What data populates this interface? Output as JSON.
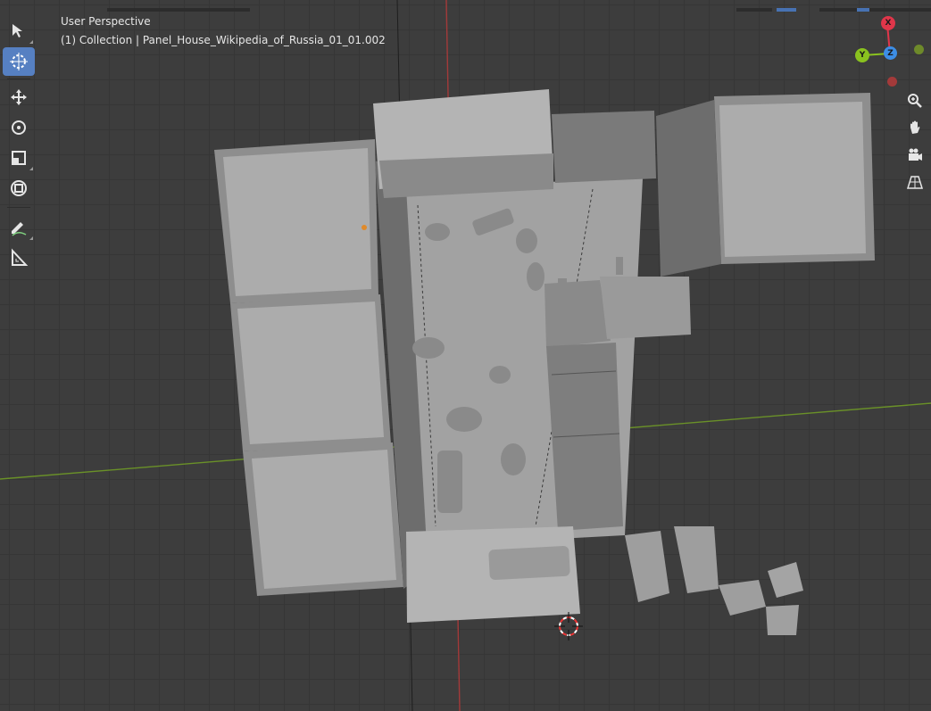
{
  "viewport": {
    "view_label": "User Perspective",
    "collection_label": "(1) Collection | Panel_House_Wikipedia_of_Russia_01_01.002"
  },
  "toolbar": {
    "tools": [
      {
        "name": "select-tool",
        "icon": "cursor-select-icon",
        "active": false
      },
      {
        "name": "cursor-tool",
        "icon": "3d-cursor-icon",
        "active": true
      },
      {
        "name": "move-tool",
        "icon": "move-arrows-icon",
        "active": false
      },
      {
        "name": "rotate-tool",
        "icon": "rotate-icon",
        "active": false
      },
      {
        "name": "scale-tool",
        "icon": "scale-icon",
        "active": false
      },
      {
        "name": "transform-tool",
        "icon": "transform-icon",
        "active": false
      },
      {
        "name": "annotate-tool",
        "icon": "annotate-pencil-icon",
        "active": false
      },
      {
        "name": "measure-tool",
        "icon": "measure-ruler-icon",
        "active": false
      }
    ]
  },
  "gizmo": {
    "x_label": "X",
    "y_label": "Y",
    "z_label": "Z",
    "colors": {
      "x": "#e0364a",
      "y": "#8ac21f",
      "z": "#3d8ee6"
    }
  },
  "nav_controls": [
    {
      "name": "zoom-button",
      "icon": "zoom-icon"
    },
    {
      "name": "pan-button",
      "icon": "hand-icon"
    },
    {
      "name": "camera-view-button",
      "icon": "camera-icon"
    },
    {
      "name": "perspective-toggle-button",
      "icon": "grid-perspective-icon"
    }
  ],
  "colors": {
    "grid_bg": "#3d3d3d",
    "x_axis_line": "#a33a3a",
    "y_axis_line": "#6a9128",
    "model_light": "#a8a8a8",
    "active_tool": "#5680c2"
  }
}
